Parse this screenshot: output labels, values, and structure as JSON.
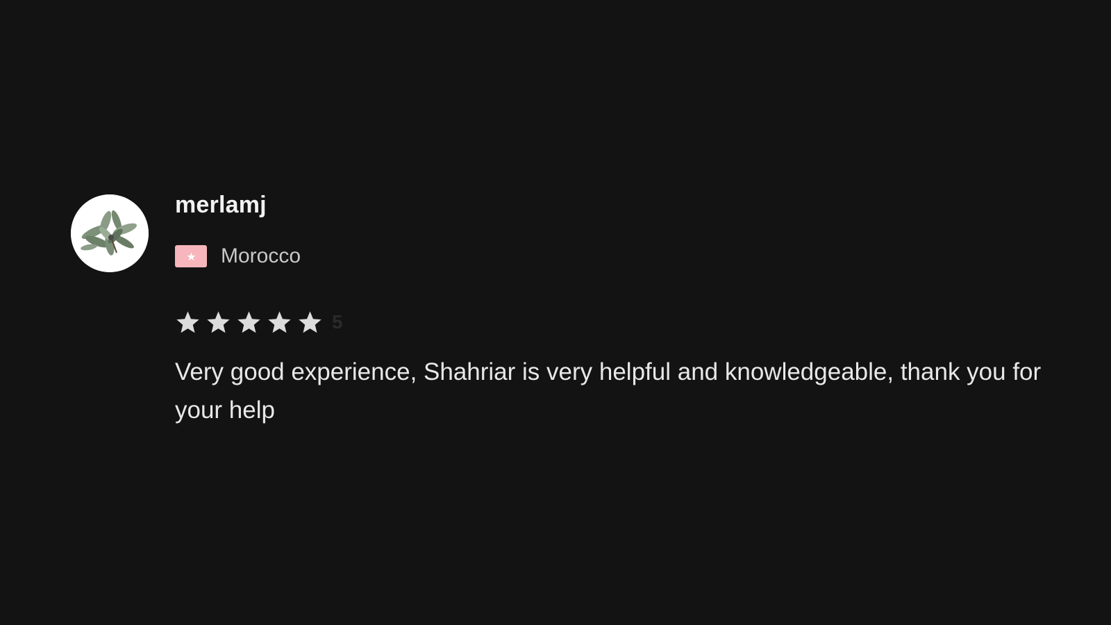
{
  "review": {
    "username": "merlamj",
    "country": "Morocco",
    "flag_icon": "morocco-flag-icon",
    "avatar_icon": "sage-plant-avatar",
    "rating": {
      "value_label": "5",
      "stars_filled": 5,
      "stars_total": 5
    },
    "text": "Very good experience, Shahriar is very helpful and knowledgeable, thank you for your help"
  },
  "colors": {
    "background": "#131313",
    "star": "#dcdcdc",
    "flag_bg": "#f7b6bb",
    "text_primary": "#e8e8e8",
    "text_secondary": "#c9c9c9",
    "rating_value": "#2a2a2a"
  }
}
